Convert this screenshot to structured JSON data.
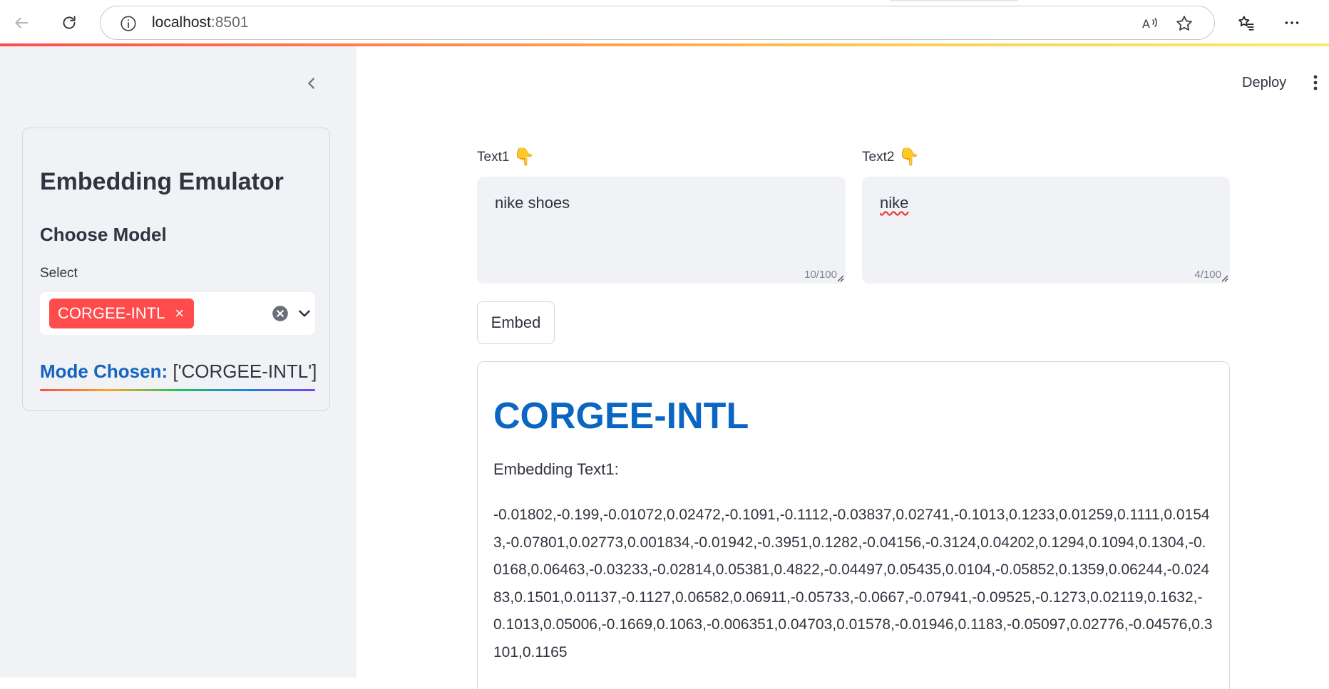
{
  "browser": {
    "address_host": "localhost",
    "address_port": ":8501"
  },
  "sidebar": {
    "title": "Embedding Emulator",
    "section_title": "Choose Model",
    "select_label": "Select",
    "selected_chips": [
      "CORGEE-INTL"
    ],
    "chip_close": "×",
    "mode_label": "Mode Chosen:",
    "mode_value": "['CORGEE-INTL']"
  },
  "header": {
    "deploy_label": "Deploy"
  },
  "inputs": {
    "text1_label": "Text1",
    "text1_icon": "👇",
    "text1_value": "nike shoes",
    "text1_counter": "10/100",
    "text2_label": "Text2",
    "text2_icon": "👇",
    "text2_value": "nike",
    "text2_counter": "4/100"
  },
  "actions": {
    "embed_label": "Embed"
  },
  "result": {
    "model_title": "CORGEE-INTL",
    "subtitle": "Embedding Text1:",
    "vector": "-0.01802,-0.199,-0.01072,0.02472,-0.1091,-0.1112,-0.03837,0.02741,-0.1013,0.1233,0.01259,0.1111,0.01543,-0.07801,0.02773,0.001834,-0.01942,-0.3951,0.1282,-0.04156,-0.3124,0.04202,0.1294,0.1094,0.1304,-0.0168,0.06463,-0.03233,-0.02814,0.05381,0.4822,-0.04497,0.05435,0.0104,-0.05852,0.1359,0.06244,-0.02483,0.1501,0.01137,-0.1127,0.06582,0.06911,-0.05733,-0.0667,-0.07941,-0.09525,-0.1273,0.02119,0.1632,-0.1013,0.05006,-0.1669,0.1063,-0.006351,0.04703,0.01578,-0.01946,0.1183,-0.05097,0.02776,-0.04576,0.3101,0.1165"
  },
  "colors": {
    "accent": "#ff4b4b",
    "link_blue": "#0a66c2",
    "sidebar_bg": "#f0f2f6"
  },
  "icons": {
    "back": "back-arrow-icon",
    "reload": "reload-icon",
    "info": "info-icon",
    "read_aloud": "read-aloud-icon",
    "favorite": "star-icon",
    "favorites_list": "favorites-icon",
    "more": "more-dots-icon",
    "collapse": "chevron-left-icon",
    "clear": "clear-circle-icon",
    "dropdown": "chevron-down-icon",
    "menu": "vertical-dots-icon"
  }
}
